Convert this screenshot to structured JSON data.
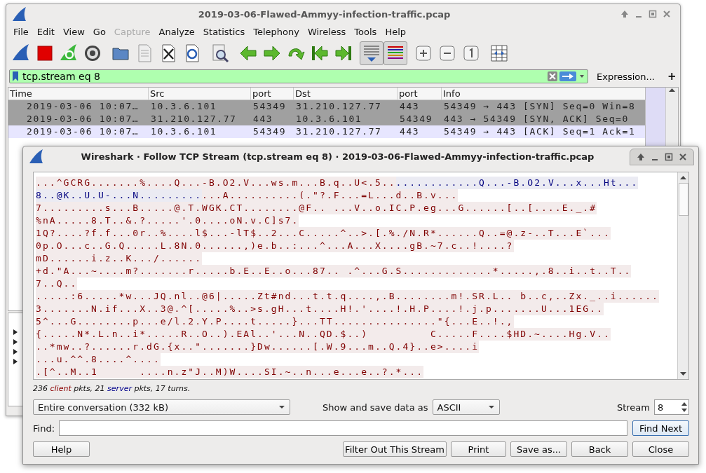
{
  "main_window": {
    "title": "2019-03-06-Flawed-Ammyy-infection-traffic.pcap",
    "menu": [
      {
        "label": "File",
        "disabled": false
      },
      {
        "label": "Edit",
        "disabled": false
      },
      {
        "label": "View",
        "disabled": false
      },
      {
        "label": "Go",
        "disabled": false
      },
      {
        "label": "Capture",
        "disabled": true
      },
      {
        "label": "Analyze",
        "disabled": false
      },
      {
        "label": "Statistics",
        "disabled": false
      },
      {
        "label": "Telephony",
        "disabled": false
      },
      {
        "label": "Wireless",
        "disabled": false
      },
      {
        "label": "Tools",
        "disabled": false
      },
      {
        "label": "Help",
        "disabled": false
      }
    ],
    "toolbar": [
      {
        "pressed": false
      },
      {
        "pressed": false
      },
      {
        "pressed": false
      },
      {
        "pressed": false
      },
      {
        "pressed": false
      },
      {
        "pressed": false
      },
      {
        "pressed": false
      },
      {
        "pressed": false
      },
      {
        "pressed": false
      },
      {
        "pressed": false
      },
      {
        "pressed": false
      },
      {
        "pressed": false
      },
      {
        "pressed": false
      },
      {
        "pressed": false
      },
      {
        "pressed": true
      },
      {
        "pressed": true
      },
      {
        "pressed": false
      },
      {
        "pressed": false
      },
      {
        "pressed": false
      },
      {
        "pressed": false
      }
    ],
    "filter": {
      "value": "tcp.stream eq 8",
      "valid": true,
      "expression_button": "Expression...",
      "add_button": "+"
    },
    "packet_list": {
      "columns": [
        "Time",
        "Src",
        "port",
        "Dst",
        "port",
        "Info"
      ],
      "rows": [
        {
          "cells": [
            "2019-03-06 10:07…",
            "10.3.6.101",
            "54349",
            "31.210.127.77",
            "443",
            "54349 → 443 [SYN] Seq=0 Win=8"
          ],
          "selected": true
        },
        {
          "cells": [
            "2019-03-06 10:07…",
            "31.210.127.77",
            "443",
            "10.3.6.101",
            "54349",
            "443 → 54349 [SYN, ACK] Seq=0"
          ],
          "selected": true
        },
        {
          "cells": [
            "2019-03-06 10:07…",
            "10.3.6.101",
            "54349",
            "31.210.127.77",
            "443",
            "54349 → 443 [ACK] Seq=1 Ack=1"
          ],
          "selected": false
        }
      ]
    }
  },
  "follow_dialog": {
    "title": "Wireshark · Follow TCP Stream (tcp.stream eq 8) · 2019-03-06-Flawed-Ammyy-infection-traffic.pcap",
    "stream_lines": [
      [
        {
          "color": "#7f0000",
          "text": "...^GCRG.......%....Q...-B.O2.V...ws.m...B.q..U<.5.."
        },
        {
          "color": "#00007f",
          "text": "............Q...-B.O2.V...x...Ht..."
        }
      ],
      [
        {
          "color": "#00007f",
          "text": "8..@K..U.U-...N........."
        },
        {
          "color": "#7f0000",
          "text": "...A..........(.\"?.F...=L...d..B.v..."
        }
      ],
      [
        {
          "color": "#7f0000",
          "text": "7.........s...B.....@.T.WGK.CT........@F.. ...V..o.IC.P.eg...G......[..[....E._.#"
        }
      ],
      [
        {
          "color": "#7f0000",
          "text": "%nA.....8.T..&.?.....'.0....oN.v.C]s7."
        }
      ],
      [
        {
          "color": "#7f0000",
          "text": "1Q?....?f.f...0r..%....l$...-lT$..2...C.....^..>.[.%./N.R*......Q..=@.z-..T...E`..."
        }
      ],
      [
        {
          "color": "#7f0000",
          "text": "0p.O...c..G.Q.....L.8N.0......,)e.b..:...^...A...X....gB.~7.c..!....?"
        }
      ],
      [
        {
          "color": "#7f0000",
          "text": "mD......i.z..K.../......"
        }
      ],
      [
        {
          "color": "#7f0000",
          "text": "+d.\"A...~....m?.......r.....b.E..E..o...87.. .^...G.S.............*.....,.8..i..t..T.."
        }
      ],
      [
        {
          "color": "#7f0000",
          "text": "7..Q.."
        }
      ],
      [
        {
          "color": "#7f0000",
          "text": ".....:6.....*w...JQ.nl..@6|.....Zt#nd...t.t.q....,.B........m!.SR.L.. b..c,..Zx._..i......"
        }
      ],
      [
        {
          "color": "#7f0000",
          "text": "3.......N.if...X..3@.^[.....%..>s.gH...t....H!.'....!.H.P....!.j.p.......U...1EG.."
        }
      ],
      [
        {
          "color": "#7f0000",
          "text": "5^...G........p...e/l.2.Y.P....t.....}...TT...............\"{...E..!.,"
        }
      ],
      [
        {
          "color": "#7f0000",
          "text": "{.....N*.L.n..i*.....R..O..).EAl..'...N..QD.$..)         C.....F....$HD.~....Hg.V.."
        }
      ],
      [
        {
          "color": "#7f0000",
          "text": "..*mw..?......r.dG.{x..\".......}Dw......[.W.9...m..Q.4}..e>....i"
        }
      ],
      [
        {
          "color": "#7f0000",
          "text": "...u.^^.8....^...."
        }
      ],
      [
        {
          "color": "#7f0000",
          "text": ".[^..M..1      ....n.z\"J..M)W....SI.~..n...e...e..?.*..."
        }
      ]
    ],
    "summary": [
      {
        "text": "236 "
      },
      {
        "text": "client",
        "color": "#8b0000"
      },
      {
        "text": " pkts, 21 "
      },
      {
        "text": "server",
        "color": "#00008b"
      },
      {
        "text": " pkts, 17 turns."
      }
    ],
    "conversation_select": "Entire conversation (332 kB)",
    "format_label": "Show and save data as",
    "format_select": "ASCII",
    "stream_label": "Stream",
    "stream_value": "8",
    "find_label": "Find:",
    "find_next_button": "Find Next",
    "buttons": [
      "Help",
      "Filter Out This Stream",
      "Print",
      "Save as...",
      "Back",
      "Close"
    ]
  }
}
